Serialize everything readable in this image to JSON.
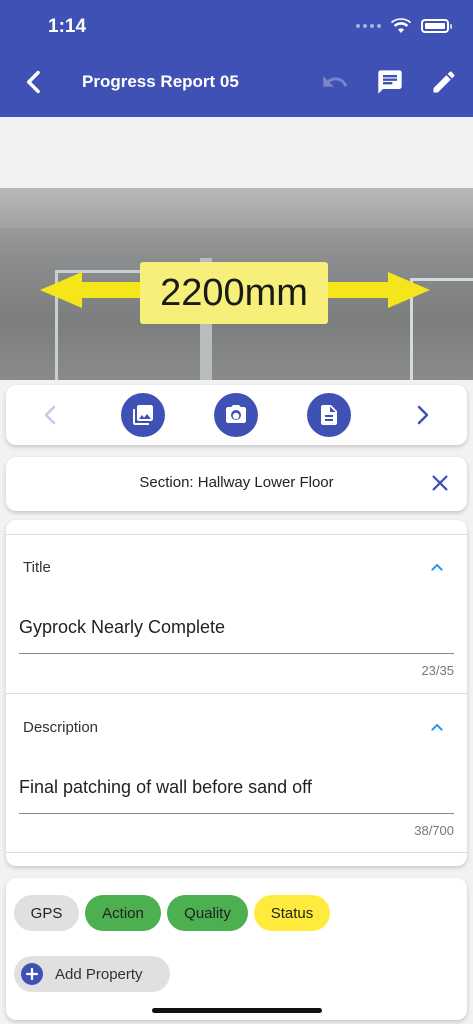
{
  "status_bar": {
    "time": "1:14"
  },
  "header": {
    "title": "Progress Report 05",
    "back_icon": "chevron-left-icon",
    "undo_icon": "undo-icon",
    "comment_icon": "comment-icon",
    "edit_icon": "pencil-icon"
  },
  "photo": {
    "measurement_label": "2200mm"
  },
  "photo_nav": {
    "prev_icon": "chevron-left-icon",
    "gallery_icon": "image-gallery-icon",
    "camera_icon": "camera-icon",
    "document_icon": "document-icon",
    "next_icon": "chevron-right-icon"
  },
  "section": {
    "label": "Section: Hallway Lower Floor"
  },
  "form": {
    "title": {
      "label": "Title",
      "value": "Gyprock Nearly Complete",
      "counter": "23/35"
    },
    "description": {
      "label": "Description",
      "value": "Final patching of wall before sand off",
      "counter": "38/700"
    }
  },
  "chips": [
    {
      "label": "GPS",
      "color": "#e0e0e0"
    },
    {
      "label": "Action",
      "color": "#4caf50"
    },
    {
      "label": "Quality",
      "color": "#4caf50"
    },
    {
      "label": "Status",
      "color": "#ffeb3b"
    }
  ],
  "add_property": {
    "label": "Add Property"
  },
  "colors": {
    "primary": "#3f51b5",
    "accent": "#2196f3"
  }
}
